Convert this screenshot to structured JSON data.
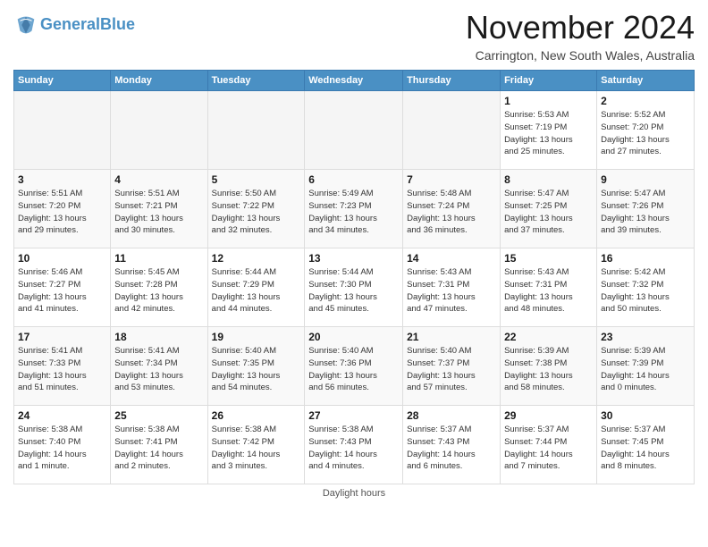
{
  "header": {
    "logo": {
      "line1": "General",
      "line2": "Blue"
    },
    "month": "November 2024",
    "location": "Carrington, New South Wales, Australia"
  },
  "days_of_week": [
    "Sunday",
    "Monday",
    "Tuesday",
    "Wednesday",
    "Thursday",
    "Friday",
    "Saturday"
  ],
  "weeks": [
    [
      {
        "day": "",
        "info": ""
      },
      {
        "day": "",
        "info": ""
      },
      {
        "day": "",
        "info": ""
      },
      {
        "day": "",
        "info": ""
      },
      {
        "day": "",
        "info": ""
      },
      {
        "day": "1",
        "info": "Sunrise: 5:53 AM\nSunset: 7:19 PM\nDaylight: 13 hours\nand 25 minutes."
      },
      {
        "day": "2",
        "info": "Sunrise: 5:52 AM\nSunset: 7:20 PM\nDaylight: 13 hours\nand 27 minutes."
      }
    ],
    [
      {
        "day": "3",
        "info": "Sunrise: 5:51 AM\nSunset: 7:20 PM\nDaylight: 13 hours\nand 29 minutes."
      },
      {
        "day": "4",
        "info": "Sunrise: 5:51 AM\nSunset: 7:21 PM\nDaylight: 13 hours\nand 30 minutes."
      },
      {
        "day": "5",
        "info": "Sunrise: 5:50 AM\nSunset: 7:22 PM\nDaylight: 13 hours\nand 32 minutes."
      },
      {
        "day": "6",
        "info": "Sunrise: 5:49 AM\nSunset: 7:23 PM\nDaylight: 13 hours\nand 34 minutes."
      },
      {
        "day": "7",
        "info": "Sunrise: 5:48 AM\nSunset: 7:24 PM\nDaylight: 13 hours\nand 36 minutes."
      },
      {
        "day": "8",
        "info": "Sunrise: 5:47 AM\nSunset: 7:25 PM\nDaylight: 13 hours\nand 37 minutes."
      },
      {
        "day": "9",
        "info": "Sunrise: 5:47 AM\nSunset: 7:26 PM\nDaylight: 13 hours\nand 39 minutes."
      }
    ],
    [
      {
        "day": "10",
        "info": "Sunrise: 5:46 AM\nSunset: 7:27 PM\nDaylight: 13 hours\nand 41 minutes."
      },
      {
        "day": "11",
        "info": "Sunrise: 5:45 AM\nSunset: 7:28 PM\nDaylight: 13 hours\nand 42 minutes."
      },
      {
        "day": "12",
        "info": "Sunrise: 5:44 AM\nSunset: 7:29 PM\nDaylight: 13 hours\nand 44 minutes."
      },
      {
        "day": "13",
        "info": "Sunrise: 5:44 AM\nSunset: 7:30 PM\nDaylight: 13 hours\nand 45 minutes."
      },
      {
        "day": "14",
        "info": "Sunrise: 5:43 AM\nSunset: 7:31 PM\nDaylight: 13 hours\nand 47 minutes."
      },
      {
        "day": "15",
        "info": "Sunrise: 5:43 AM\nSunset: 7:31 PM\nDaylight: 13 hours\nand 48 minutes."
      },
      {
        "day": "16",
        "info": "Sunrise: 5:42 AM\nSunset: 7:32 PM\nDaylight: 13 hours\nand 50 minutes."
      }
    ],
    [
      {
        "day": "17",
        "info": "Sunrise: 5:41 AM\nSunset: 7:33 PM\nDaylight: 13 hours\nand 51 minutes."
      },
      {
        "day": "18",
        "info": "Sunrise: 5:41 AM\nSunset: 7:34 PM\nDaylight: 13 hours\nand 53 minutes."
      },
      {
        "day": "19",
        "info": "Sunrise: 5:40 AM\nSunset: 7:35 PM\nDaylight: 13 hours\nand 54 minutes."
      },
      {
        "day": "20",
        "info": "Sunrise: 5:40 AM\nSunset: 7:36 PM\nDaylight: 13 hours\nand 56 minutes."
      },
      {
        "day": "21",
        "info": "Sunrise: 5:40 AM\nSunset: 7:37 PM\nDaylight: 13 hours\nand 57 minutes."
      },
      {
        "day": "22",
        "info": "Sunrise: 5:39 AM\nSunset: 7:38 PM\nDaylight: 13 hours\nand 58 minutes."
      },
      {
        "day": "23",
        "info": "Sunrise: 5:39 AM\nSunset: 7:39 PM\nDaylight: 14 hours\nand 0 minutes."
      }
    ],
    [
      {
        "day": "24",
        "info": "Sunrise: 5:38 AM\nSunset: 7:40 PM\nDaylight: 14 hours\nand 1 minute."
      },
      {
        "day": "25",
        "info": "Sunrise: 5:38 AM\nSunset: 7:41 PM\nDaylight: 14 hours\nand 2 minutes."
      },
      {
        "day": "26",
        "info": "Sunrise: 5:38 AM\nSunset: 7:42 PM\nDaylight: 14 hours\nand 3 minutes."
      },
      {
        "day": "27",
        "info": "Sunrise: 5:38 AM\nSunset: 7:43 PM\nDaylight: 14 hours\nand 4 minutes."
      },
      {
        "day": "28",
        "info": "Sunrise: 5:37 AM\nSunset: 7:43 PM\nDaylight: 14 hours\nand 6 minutes."
      },
      {
        "day": "29",
        "info": "Sunrise: 5:37 AM\nSunset: 7:44 PM\nDaylight: 14 hours\nand 7 minutes."
      },
      {
        "day": "30",
        "info": "Sunrise: 5:37 AM\nSunset: 7:45 PM\nDaylight: 14 hours\nand 8 minutes."
      }
    ]
  ],
  "footer": "Daylight hours"
}
